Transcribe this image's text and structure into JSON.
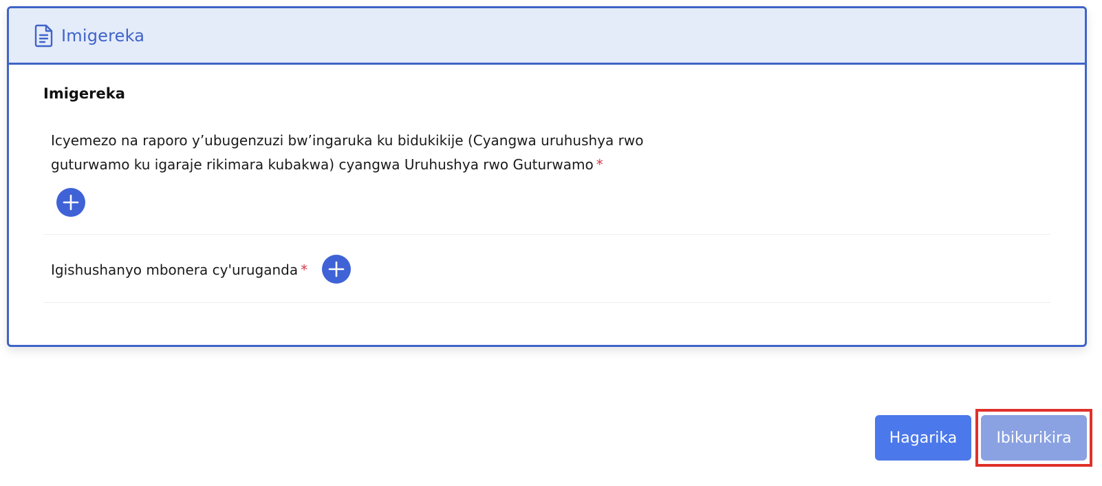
{
  "card": {
    "header_title": "Imigereka",
    "header_icon": "document-icon",
    "section_title": "Imigereka"
  },
  "requirements": [
    {
      "label": "Icyemezo na raporo y’ubugenzuzi bw’ingaruka ku bidukikije (Cyangwa uruhushya rwo guturwamo ku igaraje rikimara kubakwa) cyangwa Uruhushya rwo Guturwamo",
      "required_mark": "*",
      "add_icon": "plus-icon"
    },
    {
      "label": "Igishushanyo mbonera cy'uruganda",
      "required_mark": "*",
      "add_icon": "plus-icon"
    }
  ],
  "actions": {
    "cancel_label": "Hagarika",
    "next_label": "Ibikurikira"
  },
  "colors": {
    "accent": "#3f63c8",
    "header_bg": "#e4ecfa",
    "cancel_bg": "#4b78ea",
    "next_bg": "#8aa2e2",
    "required": "#d13a4a",
    "highlight": "#e0302a"
  }
}
